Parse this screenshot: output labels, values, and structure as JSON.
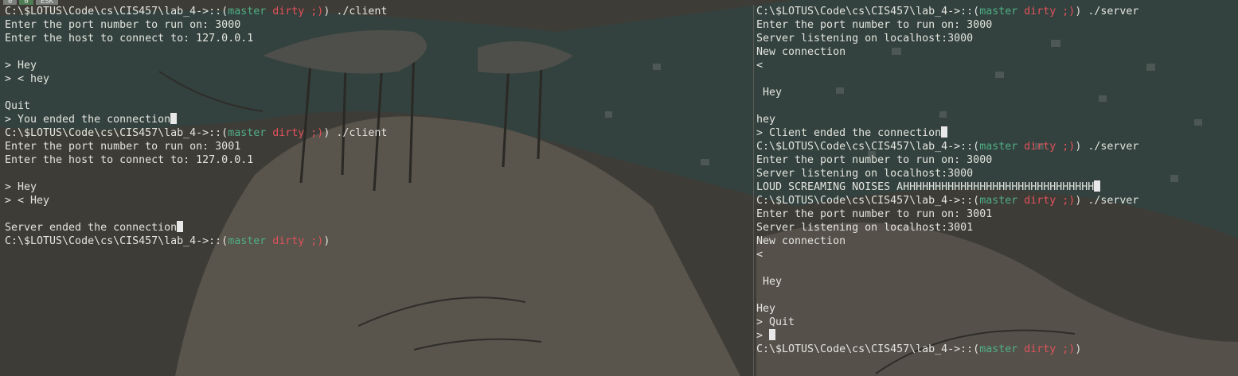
{
  "tabs": [
    "0",
    "0",
    "ESK"
  ],
  "prompt": {
    "path": "C:\\$LOTUS\\Code\\cs\\CIS457\\lab_4->::(",
    "branch": "master",
    "dirty": "dirty ;)",
    "close": ")"
  },
  "left_pane": {
    "lines": [
      {
        "prompt": true,
        "cmd": " ./client"
      },
      {
        "text": "Enter the port number to run on: 3000"
      },
      {
        "text": "Enter the host to connect to: 127.0.0.1"
      },
      {
        "text": ""
      },
      {
        "text": "> Hey"
      },
      {
        "text": "> < hey"
      },
      {
        "text": ""
      },
      {
        "text": "Quit"
      },
      {
        "text": "> You ended the connection",
        "cursor": true
      },
      {
        "prompt": true,
        "cmd": " ./client"
      },
      {
        "text": "Enter the port number to run on: 3001"
      },
      {
        "text": "Enter the host to connect to: 127.0.0.1"
      },
      {
        "text": ""
      },
      {
        "text": "> Hey"
      },
      {
        "text": "> < Hey"
      },
      {
        "text": ""
      },
      {
        "text": "Server ended the connection",
        "cursor": true
      },
      {
        "prompt": true,
        "cmd": ""
      }
    ]
  },
  "right_pane": {
    "lines": [
      {
        "prompt": true,
        "cmd": " ./server"
      },
      {
        "text": "Enter the port number to run on: 3000"
      },
      {
        "text": "Server listening on localhost:3000"
      },
      {
        "text": "New connection"
      },
      {
        "text": "<"
      },
      {
        "text": ""
      },
      {
        "text": " Hey"
      },
      {
        "text": ""
      },
      {
        "text": "hey"
      },
      {
        "text": "> Client ended the connection",
        "cursor": true
      },
      {
        "prompt": true,
        "cmd": " ./server"
      },
      {
        "text": "Enter the port number to run on: 3000"
      },
      {
        "text": "Server listening on localhost:3000"
      },
      {
        "text": "LOUD SCREAMING NOISES AHHHHHHHHHHHHHHHHHHHHHHHHHHHHHH",
        "cursor": true
      },
      {
        "prompt": true,
        "cmd": " ./server"
      },
      {
        "text": "Enter the port number to run on: 3001"
      },
      {
        "text": "Server listening on localhost:3001"
      },
      {
        "text": "New connection"
      },
      {
        "text": "<"
      },
      {
        "text": ""
      },
      {
        "text": " Hey"
      },
      {
        "text": ""
      },
      {
        "text": "Hey"
      },
      {
        "text": "> Quit"
      },
      {
        "text": "> ",
        "cursor": true
      },
      {
        "prompt": true,
        "cmd": ""
      }
    ]
  }
}
